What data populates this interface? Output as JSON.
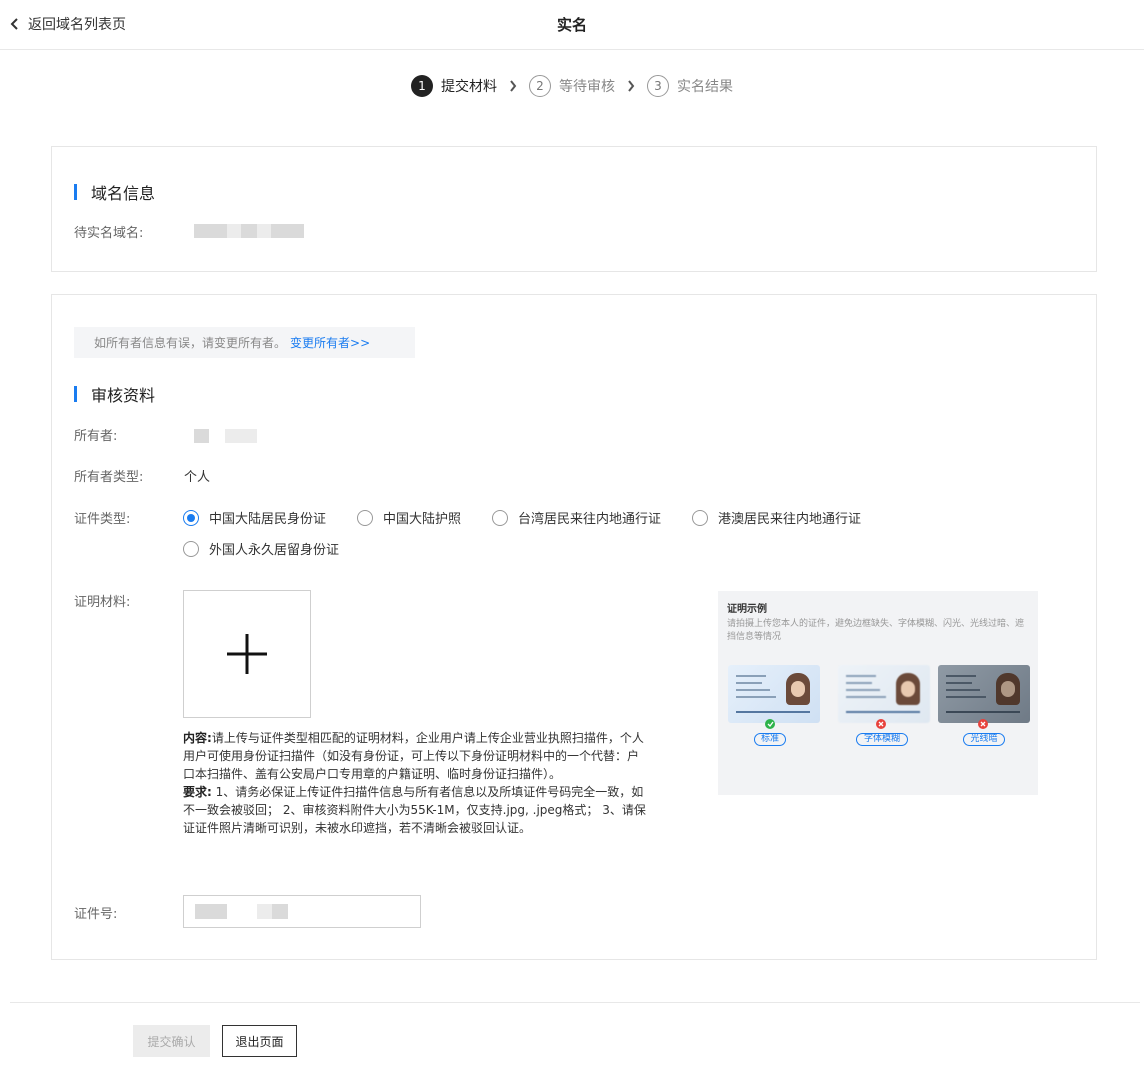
{
  "header": {
    "back_label": "返回域名列表页",
    "title": "实名"
  },
  "steps": [
    {
      "num": "1",
      "label": "提交材料",
      "active": true
    },
    {
      "num": "2",
      "label": "等待审核",
      "active": false
    },
    {
      "num": "3",
      "label": "实名结果",
      "active": false
    }
  ],
  "domain_info": {
    "title": "域名信息",
    "domain_label": "待实名域名:"
  },
  "review": {
    "notice_text": "如所有者信息有误，请变更所有者。",
    "notice_link": "变更所有者>>",
    "title": "审核资料",
    "owner_label": "所有者:",
    "owner_type_label": "所有者类型:",
    "owner_type_value": "个人",
    "cert_type_label": "证件类型:",
    "cert_types": [
      {
        "label": "中国大陆居民身份证",
        "checked": true
      },
      {
        "label": "中国大陆护照",
        "checked": false
      },
      {
        "label": "台湾居民来往内地通行证",
        "checked": false
      },
      {
        "label": "港澳居民来往内地通行证",
        "checked": false
      },
      {
        "label": "外国人永久居留身份证",
        "checked": false
      }
    ],
    "material_label": "证明材料:",
    "content_heading": "内容:",
    "content_text": "请上传与证件类型相匹配的证明材料，企业用户请上传企业营业执照扫描件，个人用户可使用身份证扫描件（如没有身份证，可上传以下身份证明材料中的一个代替：户口本扫描件、盖有公安局户口专用章的户籍证明、临时身份证扫描件）。",
    "requirement_heading": "要求:",
    "requirement_text": "1、请务必保证上传证件扫描件信息与所有者信息以及所填证件号码完全一致，如不一致会被驳回； 2、审核资料附件大小为55K-1M，仅支持.jpg, .jpeg格式； 3、请保证证件照片清晰可识别，未被水印遮挡，若不清晰会被驳回认证。",
    "example": {
      "title": "证明示例",
      "desc": "请拍摄上传您本人的证件，避免边框缺失、字体模糊、闪光、光线过暗、遮挡信息等情况",
      "tags": [
        "标准",
        "字体模糊",
        "光线暗"
      ]
    },
    "id_number_label": "证件号:"
  },
  "footer": {
    "submit_label": "提交确认",
    "exit_label": "退出页面"
  },
  "colors": {
    "accent": "#1a7cf0",
    "ok": "#2db34a",
    "error": "#e8423c"
  }
}
